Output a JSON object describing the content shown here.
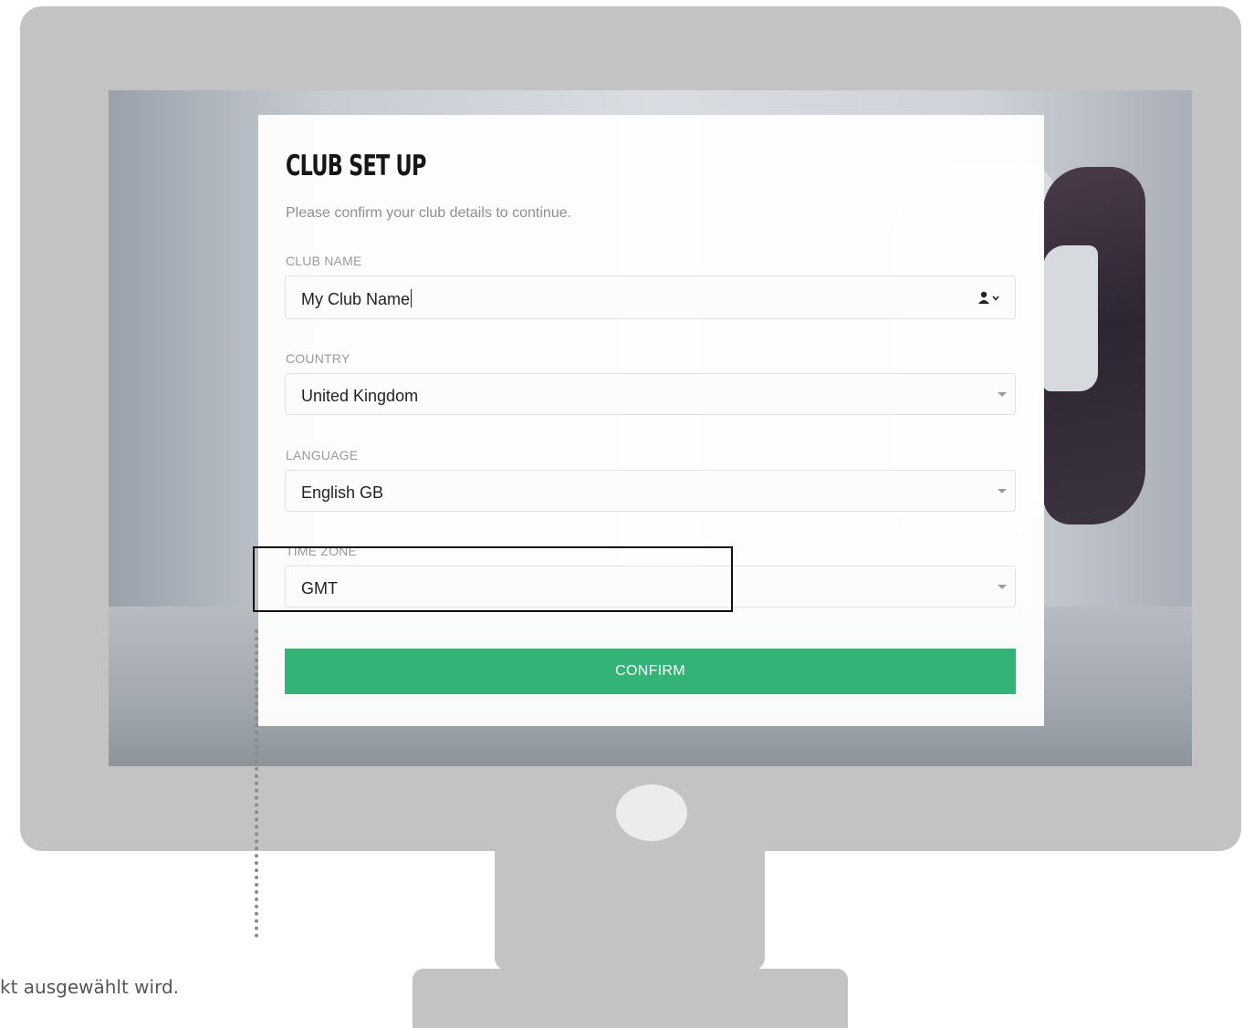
{
  "form": {
    "title": "CLUB SET UP",
    "subtitle": "Please confirm your club details to continue.",
    "club_name": {
      "label": "CLUB NAME",
      "value": "My Club Name"
    },
    "country": {
      "label": "COUNTRY",
      "value": "United Kingdom"
    },
    "language": {
      "label": "LANGUAGE",
      "value": "English GB"
    },
    "time_zone": {
      "label": "TIME ZONE",
      "value": "GMT"
    },
    "confirm_label": "CONFIRM"
  },
  "caption": "kt ausgewählt wird.",
  "colors": {
    "confirm_button": "#34b377",
    "monitor_frame": "#c3c3c3",
    "highlight_border": "#111111"
  },
  "icons": [
    "contact-autofill-icon",
    "dropdown-caret-icon"
  ]
}
